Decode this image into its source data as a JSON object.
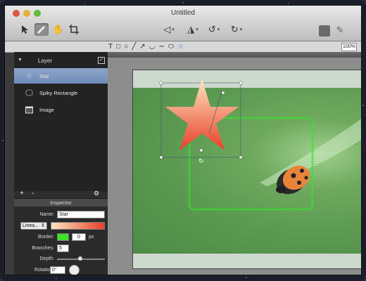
{
  "window": {
    "title": "Untitled"
  },
  "toolbar": {
    "tools": [
      "arrow-icon",
      "pencil-icon",
      "hand-icon",
      "crop-icon"
    ],
    "right_tools": [
      "flip-horizontal-icon",
      "flip-vertical-icon",
      "rotate-left-icon",
      "rotate-right-icon"
    ]
  },
  "shapebar": {
    "icons": [
      "T",
      "□",
      "○",
      "╱",
      "↗",
      "◡",
      "∼",
      "⬭",
      "☆"
    ],
    "zoom": "100%"
  },
  "layers": {
    "header": "Layer",
    "items": [
      {
        "label": "Star",
        "icon": "star-icon",
        "selected": true
      },
      {
        "label": "Spiky Rectangle",
        "icon": "spiky-rect-icon",
        "selected": false
      },
      {
        "label": "Image",
        "icon": "image-icon",
        "selected": false
      }
    ]
  },
  "footer": {
    "add": "+",
    "remove": "-",
    "gear": "⚙"
  },
  "inspector": {
    "title": "Inspector",
    "name_label": "Name:",
    "name_value": "Star",
    "fill_type": "Linea...",
    "border_label": "Border:",
    "border_width": "0",
    "border_unit": "px",
    "branches_label": "Branches:",
    "branches_value": "5",
    "depth_label": "Depth:",
    "rotation_label": "Rotation:",
    "rotation_value": "0°"
  },
  "colors": {
    "border_swatch": "#3ee02a",
    "gradient_start": "#fde6c0",
    "gradient_end": "#e8402a",
    "spiky_stroke": "#39e22c"
  }
}
